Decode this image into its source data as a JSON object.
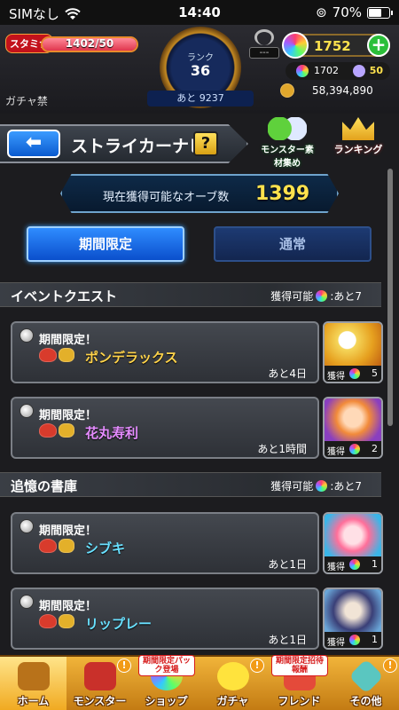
{
  "status_bar": {
    "carrier": "SIMなし",
    "time": "14:40",
    "battery_percent": "70%",
    "battery_level": 0.7
  },
  "header": {
    "stamina_label": "スタミナ",
    "stamina": "1402/50",
    "stamina_fill": 1.0,
    "gacha_ban": "ガチャ禁",
    "rank_label": "ランク",
    "rank": "36",
    "rank_next": "あと 9237",
    "lock_value": "---",
    "orbs": "1752",
    "orb_sub_1": "1702",
    "orb_sub_2": "50",
    "gold": "58,394,890"
  },
  "navi": {
    "title": "ストライカーナビ",
    "help": "?",
    "monster_material": "モンスター素材集め",
    "ranking": "ランキング"
  },
  "banner": {
    "label": "現在獲得可能なオーブ数",
    "value": "1399"
  },
  "tabs": [
    {
      "label": "期間限定",
      "active": true
    },
    {
      "label": "通常",
      "active": false
    }
  ],
  "sections": [
    {
      "title": "イベントクエスト",
      "right_label": "獲得可能",
      "right_value": ":あと7"
    },
    {
      "title": "追憶の書庫",
      "right_label": "獲得可能",
      "right_value": ":あと7"
    }
  ],
  "quests": [
    {
      "tag": "期間限定！",
      "name": "ポンデラックス",
      "name_color": "#ffd34a",
      "remaining": "あと4日",
      "get_label": "獲得",
      "get_count": "5"
    },
    {
      "tag": "期間限定！",
      "name": "花丸寿利",
      "name_color": "#e58cff",
      "remaining": "あと1時間",
      "get_label": "獲得",
      "get_count": "2"
    },
    {
      "tag": "期間限定！",
      "name": "シブキ",
      "name_color": "#69e0ff",
      "remaining": "あと1日",
      "get_label": "獲得",
      "get_count": "1"
    },
    {
      "tag": "期間限定！",
      "name": "リップレー",
      "name_color": "#69e0ff",
      "remaining": "あと1日",
      "get_label": "獲得",
      "get_count": "1"
    }
  ],
  "bottom_nav": [
    {
      "label": "ホーム",
      "badge": "",
      "icon": "home-icon"
    },
    {
      "label": "モンスター",
      "badge": "",
      "icon": "monster-icon"
    },
    {
      "label": "ショップ",
      "badge": "期間限定パック登場",
      "icon": "shop-icon"
    },
    {
      "label": "ガチャ",
      "badge": "",
      "icon": "gacha-icon"
    },
    {
      "label": "フレンド",
      "badge": "期間限定招待報酬",
      "icon": "friend-icon"
    },
    {
      "label": "その他",
      "badge": "",
      "icon": "other-icon"
    }
  ]
}
